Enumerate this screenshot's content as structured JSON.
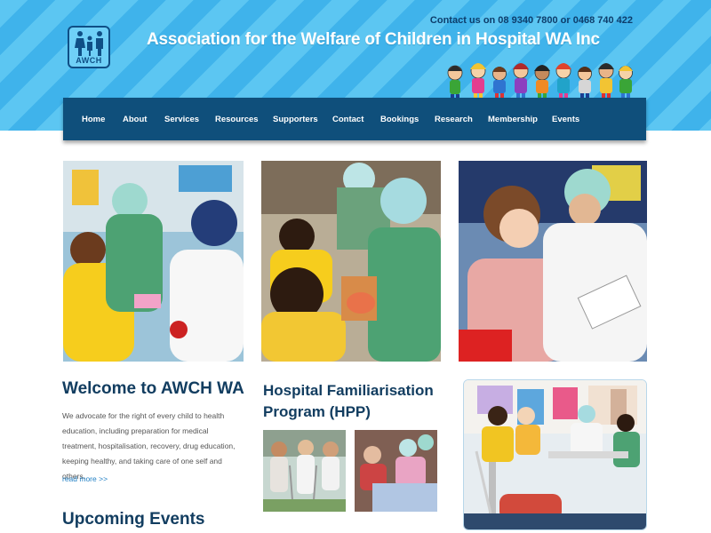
{
  "header": {
    "contact": "Contact us on 08 9340 7800 or 0468 740 422",
    "title": "Association for the Welfare of Children in Hospital WA Inc",
    "logo_text": "AWCH"
  },
  "nav": {
    "items": [
      "Home",
      "About",
      "Services",
      "Resources",
      "Supporters",
      "Contact",
      "Bookings",
      "Research",
      "Membership",
      "Events"
    ]
  },
  "welcome": {
    "heading": "Welcome to AWCH WA",
    "body": "We advocate for the right of every child to health education, including preparation for medical treatment, hospitalisation, recovery, drug education, keeping healthy, and taking care of one self and others.",
    "read_more": "read more >>"
  },
  "hpp": {
    "heading": "Hospital Familiarisation Program (HPP)"
  },
  "events": {
    "heading": "Upcoming Events"
  },
  "colors": {
    "header_stripe_a": "#5cc6f2",
    "header_stripe_b": "#3fb3eb",
    "nav_bg": "#0f4f7b",
    "heading": "#123d60",
    "link": "#1f7fc4"
  }
}
